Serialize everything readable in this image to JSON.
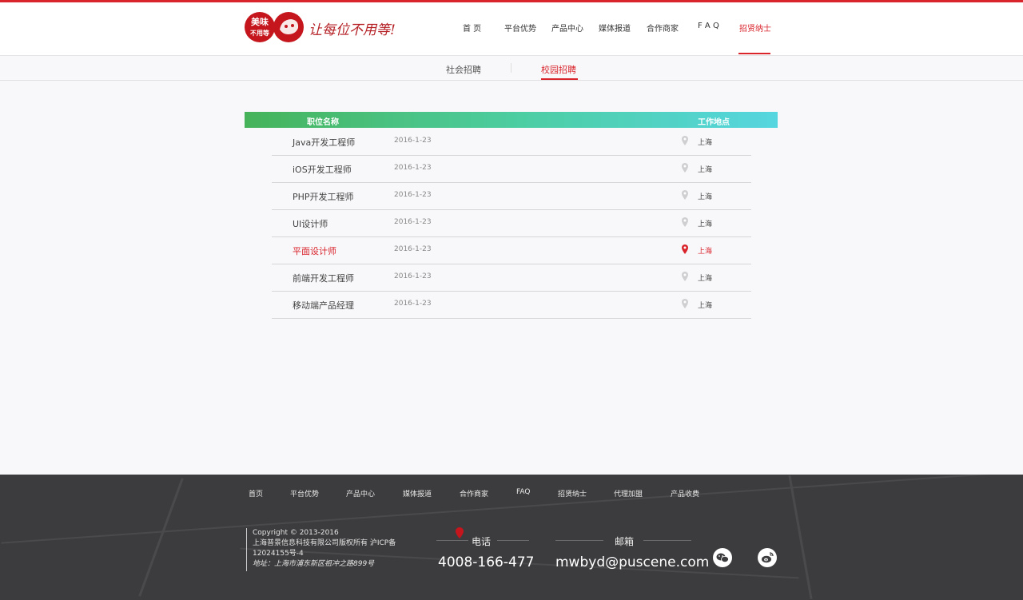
{
  "brand": {
    "logo_text_line1": "美味",
    "logo_text_line2": "不用等",
    "slogan": "让每位不用等!"
  },
  "nav": {
    "items": [
      {
        "label": "首 页",
        "active": false
      },
      {
        "label": "平台优势",
        "active": false
      },
      {
        "label": "产品中心",
        "active": false
      },
      {
        "label": "媒体报道",
        "active": false
      },
      {
        "label": "合作商家",
        "active": false
      },
      {
        "label": "F A Q",
        "active": false
      },
      {
        "label": "招贤纳士",
        "active": true
      }
    ]
  },
  "subnav": {
    "tabs": [
      {
        "label": "社会招聘",
        "active": false
      },
      {
        "label": "校园招聘",
        "active": true
      }
    ]
  },
  "table": {
    "headers": {
      "position": "职位名称",
      "location": "工作地点"
    },
    "rows": [
      {
        "title": "Java开发工程师",
        "date": "2016-1-23",
        "location": "上海"
      },
      {
        "title": "iOS开发工程师",
        "date": "2016-1-23",
        "location": "上海"
      },
      {
        "title": "PHP开发工程师",
        "date": "2016-1-23",
        "location": "上海"
      },
      {
        "title": "UI设计师",
        "date": "2016-1-23",
        "location": "上海"
      },
      {
        "title": "平面设计师",
        "date": "2016-1-23",
        "location": "上海",
        "active": true
      },
      {
        "title": "前端开发工程师",
        "date": "2016-1-23",
        "location": "上海"
      },
      {
        "title": "移动端产品经理",
        "date": "2016-1-23",
        "location": "上海"
      }
    ]
  },
  "footer": {
    "nav": [
      "首页",
      "平台优势",
      "产品中心",
      "媒体报道",
      "合作商家",
      "FAQ",
      "招贤纳士",
      "代理加盟",
      "产品收费"
    ],
    "copyright_line1": "Copyright © 2013-2016",
    "copyright_line2": "上海普景信息科技有限公司版权所有 沪ICP备",
    "copyright_line3": "12024155号-4",
    "address": "地址：上海市浦东新区祖冲之路899号",
    "phone_label": "电话",
    "phone": "4008-166-477",
    "email_label": "邮箱",
    "email": "mwbyd@puscene.com"
  },
  "colors": {
    "accent": "#d9242c",
    "footer_bg": "#3c3c3e"
  }
}
